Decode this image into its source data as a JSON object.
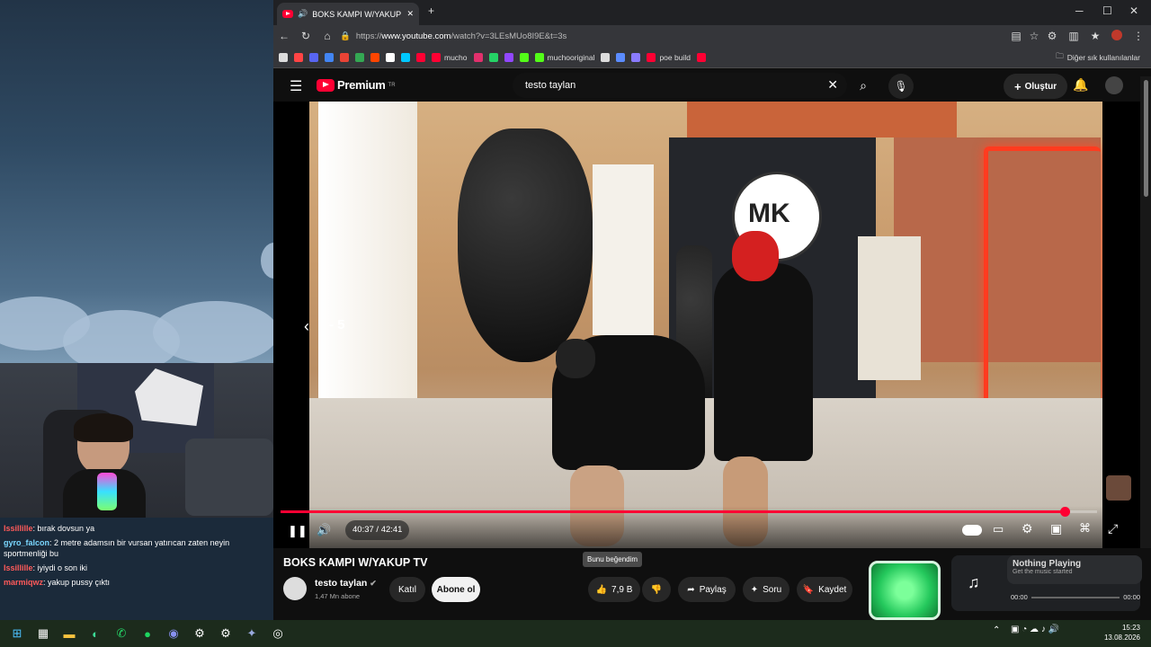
{
  "desktop": {
    "chat": [
      {
        "user": "Issillille",
        "text": ": bırak dovsun ya"
      },
      {
        "user": "gyro_falcon",
        "text": ": 2 metre adamsın bir vursan yatırıcan zaten neyin sportmenliği bu"
      },
      {
        "user": "Issillille",
        "text": ": iyiydi o son iki"
      },
      {
        "user": "marmiqwz",
        "text": ": yakup pussy çıktı"
      }
    ]
  },
  "browser": {
    "tab_title": "BOKS KAMPI W/YAKUP TV - Y",
    "tab_close": "✕",
    "new_tab": "+",
    "url_prefix": "https://",
    "url_host": "www.youtube.com",
    "url_path": "/watch?v=3LEsMUo8I9E&t=3s",
    "bookmarks": [
      {
        "label": "",
        "color": "#dddddd"
      },
      {
        "label": "",
        "color": "#ff4444"
      },
      {
        "label": "",
        "color": "#5865f2"
      },
      {
        "label": "",
        "color": "#4285f4"
      },
      {
        "label": "",
        "color": "#ea4335"
      },
      {
        "label": "",
        "color": "#34a853"
      },
      {
        "label": "",
        "color": "#ff4500"
      },
      {
        "label": "",
        "color": "#ffffff"
      },
      {
        "label": "",
        "color": "#00c8ff"
      },
      {
        "label": "",
        "color": "#ff0033"
      },
      {
        "label": "mucho",
        "color": "#ff0033"
      },
      {
        "label": "",
        "color": "#e1306c"
      },
      {
        "label": "",
        "color": "#25d366"
      },
      {
        "label": "",
        "color": "#9147ff"
      },
      {
        "label": "",
        "color": "#53fc18"
      },
      {
        "label": "muchooriginal",
        "color": "#53fc18"
      },
      {
        "label": "",
        "color": "#dddddd"
      },
      {
        "label": "",
        "color": "#5b8cff"
      },
      {
        "label": "",
        "color": "#8a7bff"
      },
      {
        "label": "poe build",
        "color": "#ff0033"
      },
      {
        "label": "",
        "color": "#ff0033"
      }
    ],
    "other_bookmarks": "Diğer sık kullanılanlar"
  },
  "youtube": {
    "logo_text": "Premium",
    "logo_sup": "TR",
    "search_value": "testo taylan",
    "create_label": "Oluştur",
    "video": {
      "seek_indicator": "- 5",
      "time": "40:37 / 42:41",
      "progress": 0.96,
      "title": "BOKS KAMPI W/YAKUP TV"
    },
    "channel": {
      "name": "testo taylan",
      "subs": "1,47 Mn abone",
      "join_label": "Katıl",
      "subscribe_label": "Abone ol"
    },
    "actions": {
      "like_count": "7,9 B",
      "like_tooltip": "Bunu beğendim",
      "share_label": "Paylaş",
      "ask_label": "Soru",
      "save_label": "Kaydet"
    }
  },
  "now_playing": {
    "title": "Nothing Playing",
    "subtitle": "Get the music started",
    "time_start": "00:00",
    "time_end": "00:00"
  },
  "taskbar": {
    "time": "15:23",
    "date": "13.08.2026"
  }
}
